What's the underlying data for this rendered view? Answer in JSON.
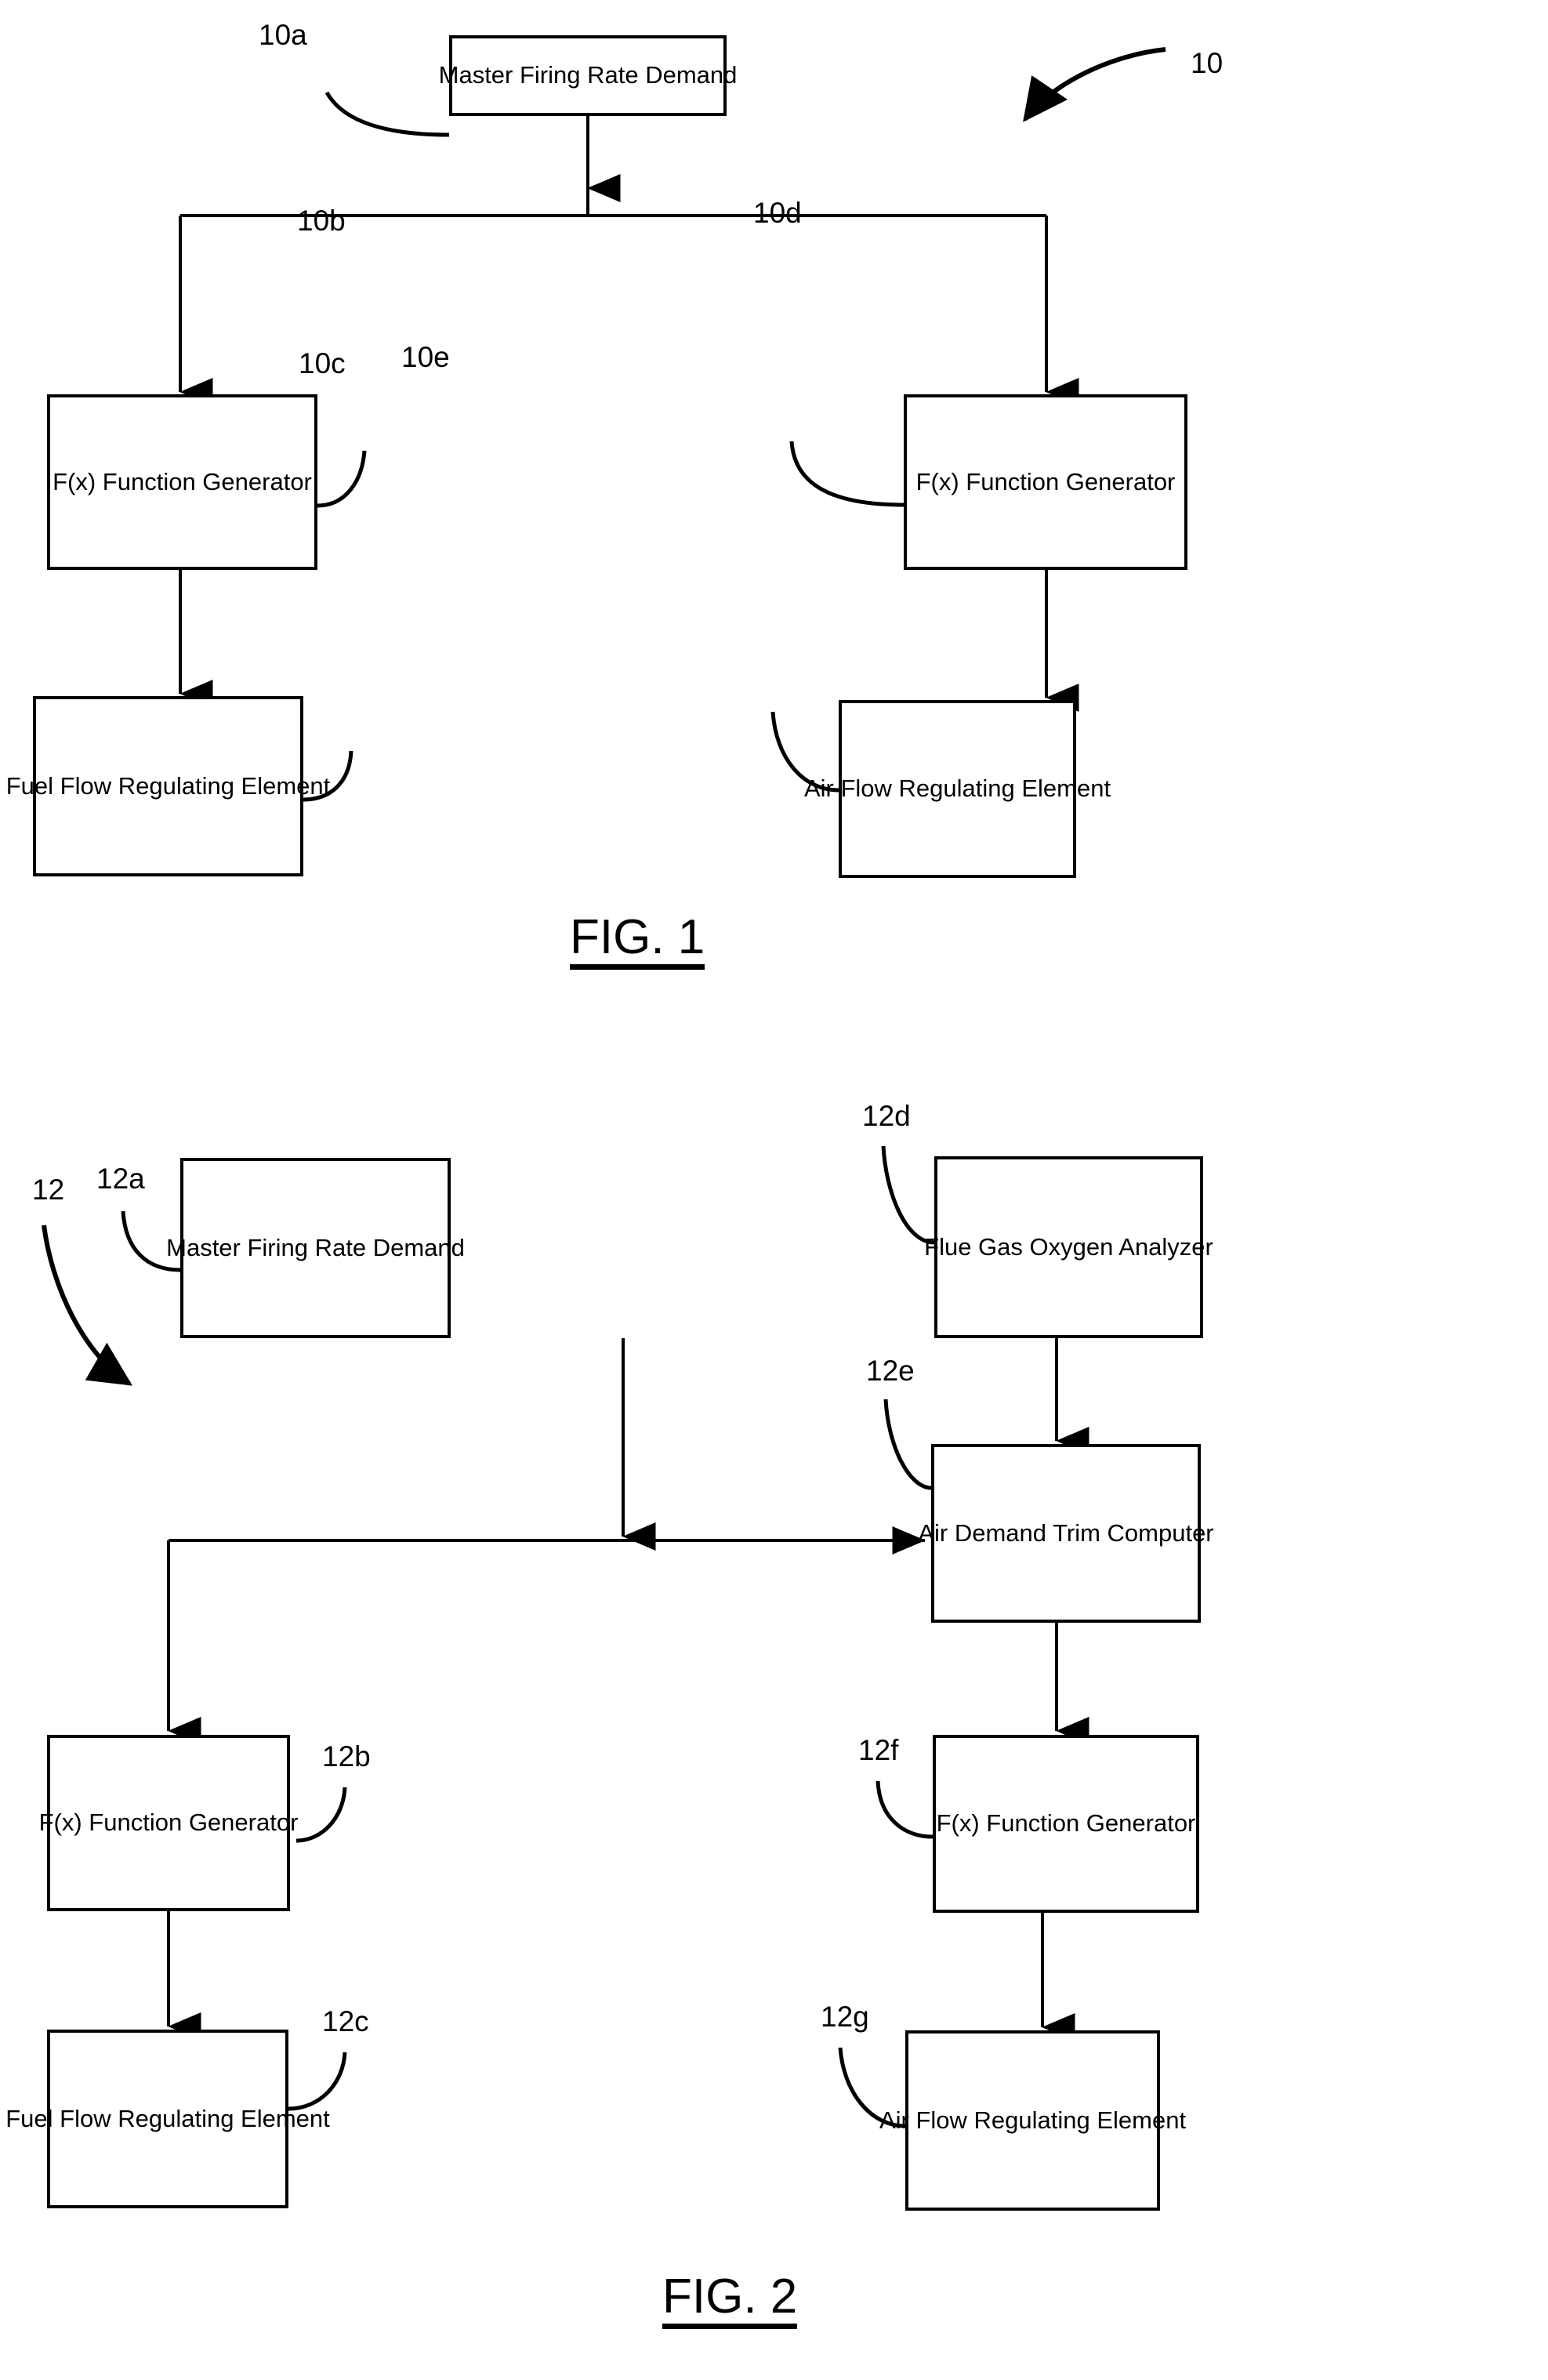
{
  "figures": [
    {
      "id": "fig1",
      "caption": "FIG. 1",
      "system_ref": "10",
      "blocks": [
        {
          "ref": "10a",
          "label": "Master Firing Rate Demand"
        },
        {
          "ref": "10b",
          "label": "F(x) Function Generator"
        },
        {
          "ref": "10c",
          "label": "Fuel Flow Regulating Element"
        },
        {
          "ref": "10d",
          "label": "F(x) Function Generator"
        },
        {
          "ref": "10e",
          "label": "Air Flow Regulating Element"
        }
      ]
    },
    {
      "id": "fig2",
      "caption": "FIG. 2",
      "system_ref": "12",
      "blocks": [
        {
          "ref": "12a",
          "label": "Master Firing Rate Demand"
        },
        {
          "ref": "12b",
          "label": "F(x) Function Generator"
        },
        {
          "ref": "12c",
          "label": "Fuel Flow Regulating Element"
        },
        {
          "ref": "12d",
          "label": "Flue Gas Oxygen Analyzer"
        },
        {
          "ref": "12e",
          "label": "Air Demand Trim Computer"
        },
        {
          "ref": "12f",
          "label": "F(x) Function Generator"
        },
        {
          "ref": "12g",
          "label": "Air Flow Regulating Element"
        }
      ]
    }
  ],
  "colors": {
    "ink": "#000000",
    "paper": "#ffffff"
  }
}
